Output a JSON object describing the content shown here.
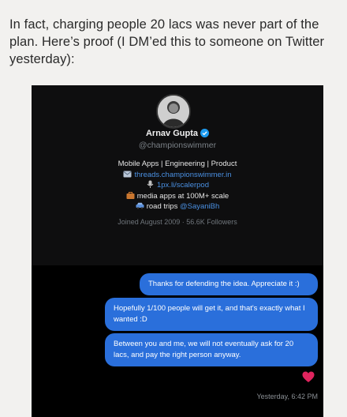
{
  "post": {
    "text": "In fact, charging people 20 lacs was never part of the plan. Here’s proof (I DM’ed this to someone on Twitter yesterday):"
  },
  "profile": {
    "name": "Arnav Gupta",
    "handle": "@championswimmer",
    "bio": {
      "line1": "Mobile Apps | Engineering | Product",
      "line2": "threads.championswimmer.in",
      "line3": "1px.li/scalerpod",
      "line4": "media apps at 100M+ scale",
      "line5_text": "road trips ",
      "line5_link": "@SayaniBh"
    },
    "joined": "Joined August 2009 · 56.6K Followers"
  },
  "chat": {
    "messages": [
      "Thanks for defending the idea. Appreciate it :)",
      "Hopefully 1/100 people will get it, and that's exactly what I wanted :D",
      "Between you and me, we will not eventually ask for 20 lacs, and pay the right person anyway."
    ],
    "timestamp": "Yesterday, 6:42 PM"
  },
  "colors": {
    "bubble": "#2a6fdb",
    "link": "#4a90e2",
    "heart": "#e0245e",
    "verified": "#1d9bf0"
  }
}
